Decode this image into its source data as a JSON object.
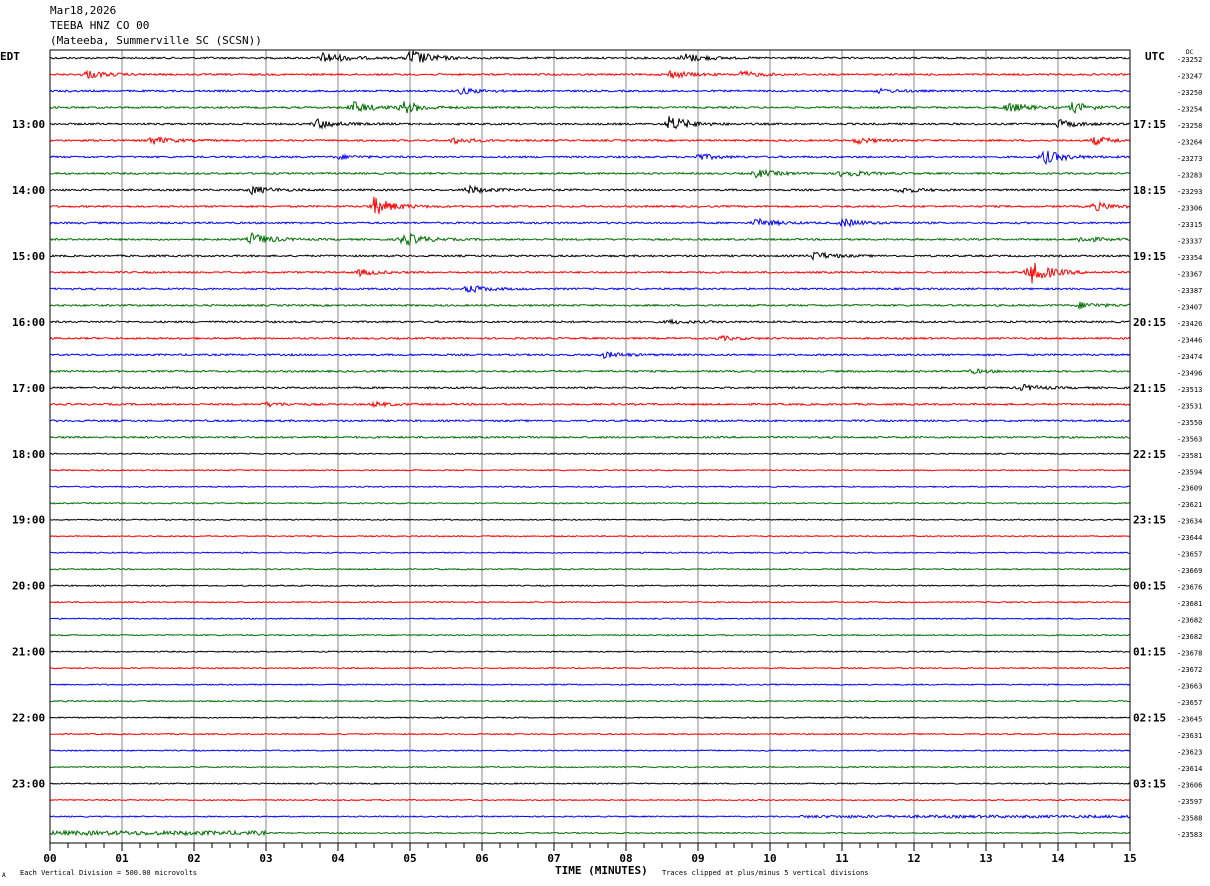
{
  "header": {
    "date": "Mar18,2026",
    "station": "TEEBA HNZ CO 00",
    "location": "(Mateeba, Summerville SC (SCSN))"
  },
  "chart_data": {
    "type": "line",
    "title": "TEEBA HNZ CO 00 helicorder",
    "left_timezone": "EDT",
    "right_timezone": "UTC",
    "dc_label": "DC",
    "xlabel": "TIME (MINUTES)",
    "x_ticks": [
      "00",
      "01",
      "02",
      "03",
      "04",
      "05",
      "06",
      "07",
      "08",
      "09",
      "10",
      "11",
      "12",
      "13",
      "14",
      "15"
    ],
    "xlim": [
      0,
      15
    ],
    "left_hour_labels": [
      "13:00",
      "14:00",
      "15:00",
      "16:00",
      "17:00",
      "18:00",
      "19:00",
      "20:00",
      "21:00",
      "22:00",
      "23:00"
    ],
    "right_hour_labels": [
      "17:15",
      "18:15",
      "19:15",
      "20:15",
      "21:15",
      "22:15",
      "23:15",
      "00:15",
      "01:15",
      "02:15",
      "03:15"
    ],
    "dc_offsets": [
      -23252,
      -23247,
      -23250,
      -23254,
      -23258,
      -23264,
      -23273,
      -23283,
      -23293,
      -23306,
      -23315,
      -23337,
      -23354,
      -23367,
      -23387,
      -23407,
      -23426,
      -23446,
      -23474,
      -23496,
      -23513,
      -23531,
      -23550,
      -23563,
      -23581,
      -23594,
      -23609,
      -23621,
      -23634,
      -23644,
      -23657,
      -23669,
      -23676,
      -23681,
      -23682,
      -23682,
      -23678,
      -23672,
      -23663,
      -23657,
      -23645,
      -23631,
      -23623,
      -23614,
      -23606,
      -23597,
      -23588,
      -23583
    ],
    "trace_colors": [
      "#000000",
      "#ff0000",
      "#0000ff",
      "#007000"
    ],
    "events": [
      [
        0,
        3.8,
        6
      ],
      [
        0,
        5,
        9
      ],
      [
        0,
        8.8,
        5
      ],
      [
        1,
        0.5,
        4
      ],
      [
        1,
        8.6,
        4
      ],
      [
        1,
        9.6,
        3
      ],
      [
        2,
        5.7,
        3
      ],
      [
        2,
        11.5,
        2
      ],
      [
        3,
        4.2,
        6
      ],
      [
        3,
        4.9,
        6
      ],
      [
        3,
        13.3,
        5
      ],
      [
        3,
        14.2,
        5
      ],
      [
        4,
        3.7,
        5
      ],
      [
        4,
        8.6,
        8
      ],
      [
        4,
        14.0,
        4
      ],
      [
        5,
        1.4,
        4
      ],
      [
        5,
        5.6,
        3
      ],
      [
        5,
        11.2,
        3
      ],
      [
        5,
        14.5,
        4
      ],
      [
        6,
        4,
        2
      ],
      [
        6,
        9,
        3
      ],
      [
        6,
        13.8,
        7
      ],
      [
        7,
        9.8,
        4
      ],
      [
        7,
        11,
        4
      ],
      [
        8,
        2.8,
        4
      ],
      [
        8,
        5.8,
        4
      ],
      [
        8,
        11.8,
        3
      ],
      [
        9,
        4.5,
        9
      ],
      [
        9,
        14.5,
        4
      ],
      [
        10,
        9.8,
        4
      ],
      [
        10,
        11,
        4
      ],
      [
        11,
        2.8,
        6
      ],
      [
        11,
        4.9,
        7
      ],
      [
        11,
        14.3,
        3
      ],
      [
        12,
        10.6,
        4
      ],
      [
        13,
        4.3,
        3
      ],
      [
        13,
        13.6,
        12
      ],
      [
        14,
        5.8,
        4
      ],
      [
        15,
        14.3,
        3
      ],
      [
        16,
        8.6,
        2
      ],
      [
        17,
        9.3,
        2
      ],
      [
        18,
        7.7,
        3
      ],
      [
        19,
        12.8,
        2
      ],
      [
        20,
        13.5,
        3
      ],
      [
        21,
        3,
        2
      ],
      [
        21,
        4.5,
        2
      ]
    ],
    "footer_left": "Each Vertical Division =  500.00 microvolts",
    "footer_right": "Traces clipped at plus/minus 5 vertical divisions",
    "footer_mark": "A"
  }
}
